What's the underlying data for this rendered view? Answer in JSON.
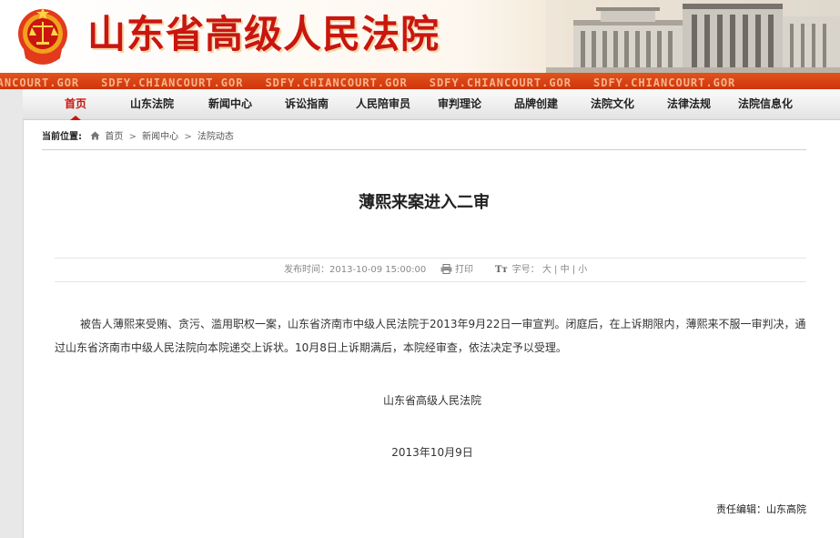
{
  "header": {
    "site_title": "山东省高级人民法院",
    "stripe_text": [
      "CHIANCOURT.GOR",
      "SDFY.CHIANCOURT.GOR",
      "SDFY.CHIANCOURT.GOR",
      "SDFY.CHIANCOURT.GOR",
      "SDFY.CHIANCOURT.GOR"
    ],
    "colors": {
      "brand_red": "#c9160f",
      "stripe_orange": "#d9400f"
    }
  },
  "nav": {
    "items": [
      {
        "label": "首页",
        "active": true
      },
      {
        "label": "山东法院"
      },
      {
        "label": "新闻中心"
      },
      {
        "label": "诉讼指南"
      },
      {
        "label": "人民陪审员"
      },
      {
        "label": "审判理论"
      },
      {
        "label": "品牌创建"
      },
      {
        "label": "法院文化"
      },
      {
        "label": "法律法规"
      },
      {
        "label": "法院信息化"
      }
    ]
  },
  "breadcrumb": {
    "label": "当前位置:",
    "items": [
      "首页",
      "新闻中心",
      "法院动态"
    ],
    "separator": ">"
  },
  "article": {
    "title": "薄熙来案进入二审",
    "publish_label": "发布时间：2013-10-09 15:00:00",
    "print_label": "打印",
    "font_label": "字号：",
    "font_sizes": [
      "大",
      "中",
      "小"
    ],
    "body": "被告人薄熙来受贿、贪污、滥用职权一案，山东省济南市中级人民法院于2013年9月22日一审宣判。闭庭后，在上诉期限内，薄熙来不服一审判决，通过山东省济南市中级人民法院向本院递交上诉状。10月8日上诉期满后，本院经审查，依法决定予以受理。",
    "signature": "山东省高级人民法院",
    "date": "2013年10月9日",
    "editor": "责任编辑：山东高院"
  }
}
